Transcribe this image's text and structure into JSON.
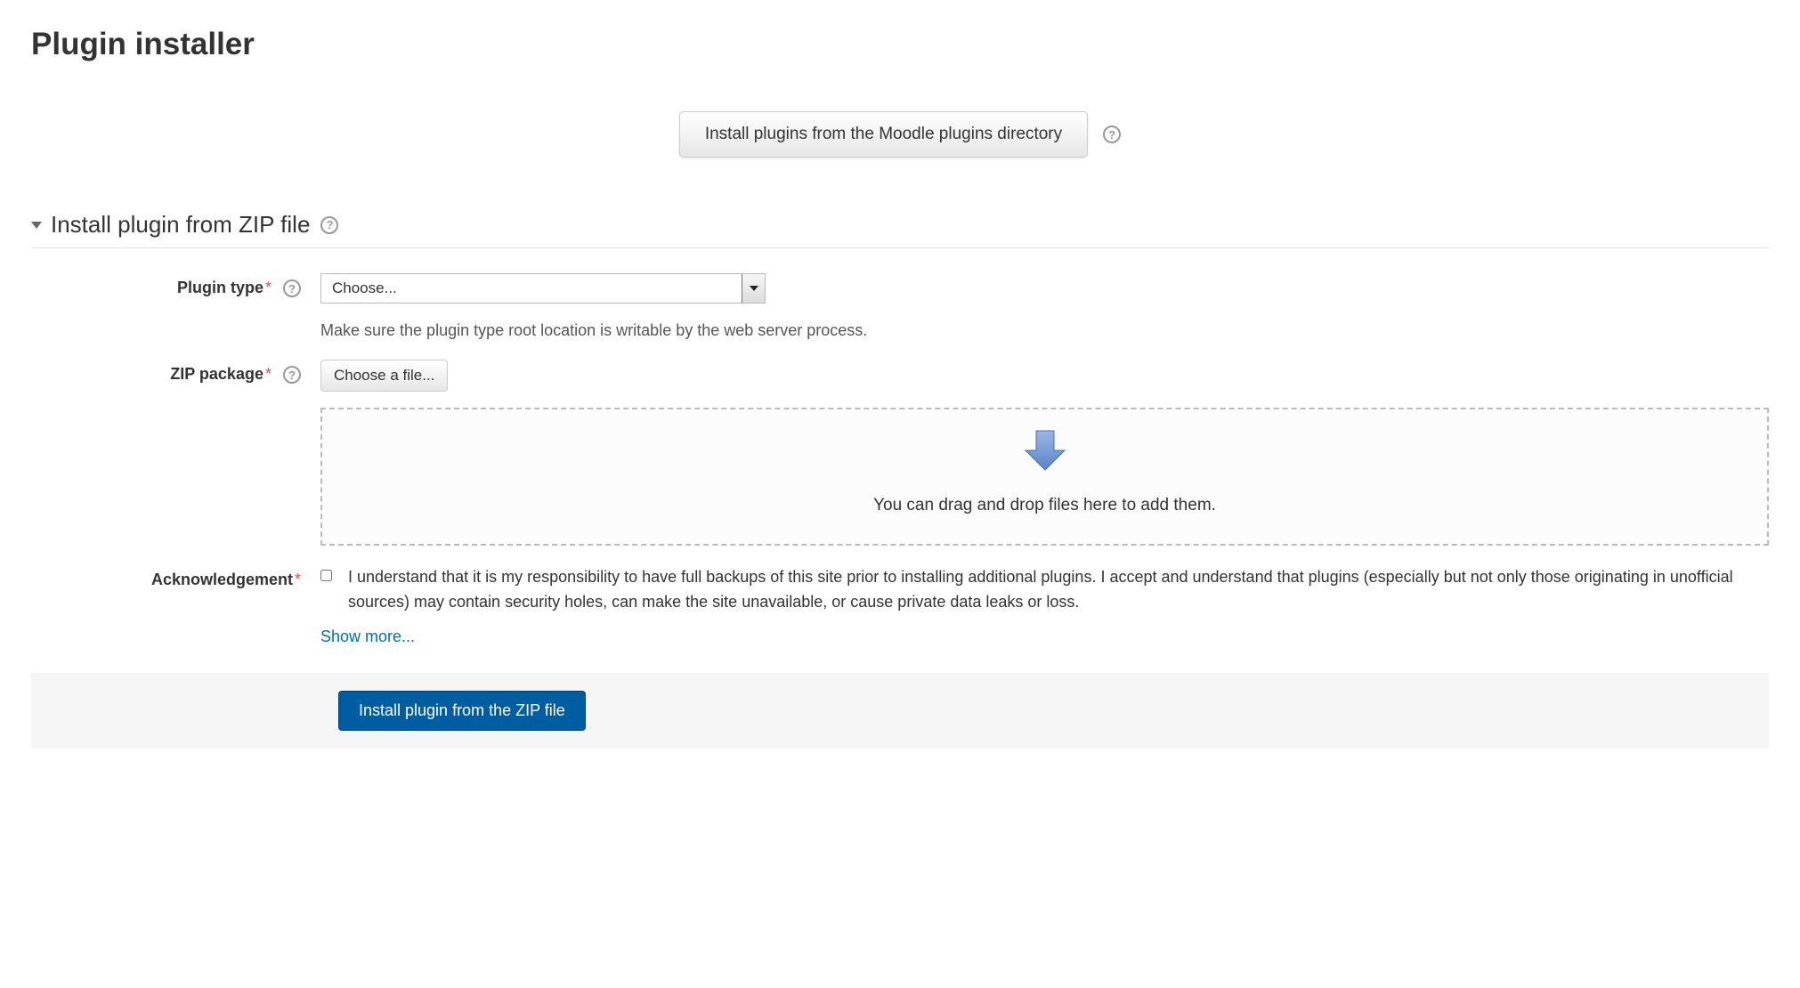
{
  "page": {
    "title": "Plugin installer"
  },
  "hero": {
    "install_from_directory": "Install plugins from the Moodle plugins directory"
  },
  "section": {
    "title": "Install plugin from ZIP file"
  },
  "form": {
    "plugin_type": {
      "label": "Plugin type",
      "selected": "Choose...",
      "hint": "Make sure the plugin type root location is writable by the web server process."
    },
    "zip_package": {
      "label": "ZIP package",
      "choose_file": "Choose a file...",
      "dropzone_text": "You can drag and drop files here to add them."
    },
    "acknowledgement": {
      "label": "Acknowledgement",
      "text": "I understand that it is my responsibility to have full backups of this site prior to installing additional plugins. I accept and understand that plugins (especially but not only those originating in unofficial sources) may contain security holes, can make the site unavailable, or cause private data leaks or loss.",
      "show_more": "Show more..."
    },
    "submit": "Install plugin from the ZIP file"
  }
}
